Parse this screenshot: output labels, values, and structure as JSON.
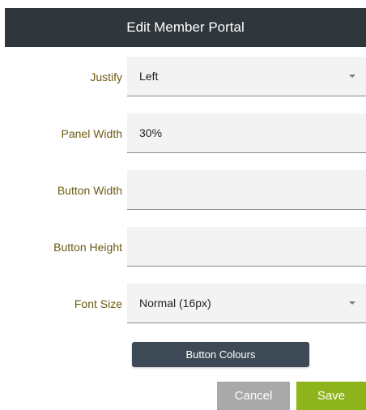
{
  "dialog": {
    "title": "Edit Member Portal"
  },
  "form": {
    "justify": {
      "label": "Justify",
      "value": "Left",
      "control": "select"
    },
    "panel_width": {
      "label": "Panel Width",
      "value": "30%",
      "control": "text"
    },
    "button_width": {
      "label": "Button Width",
      "value": "",
      "control": "text"
    },
    "button_height": {
      "label": "Button Height",
      "value": "",
      "control": "text"
    },
    "font_size": {
      "label": "Font Size",
      "value": "Normal (16px)",
      "control": "select"
    }
  },
  "buttons": {
    "button_colours": "Button Colours",
    "cancel": "Cancel",
    "save": "Save"
  },
  "colors": {
    "header_bg": "#2f373d",
    "label_text": "#6b5a12",
    "field_bg": "#f3f3f3",
    "colours_button_bg": "#3d4954",
    "cancel_bg": "#a9a9a9",
    "save_bg": "#8db51b"
  },
  "icons": {
    "select_caret": "caret-down-icon"
  }
}
